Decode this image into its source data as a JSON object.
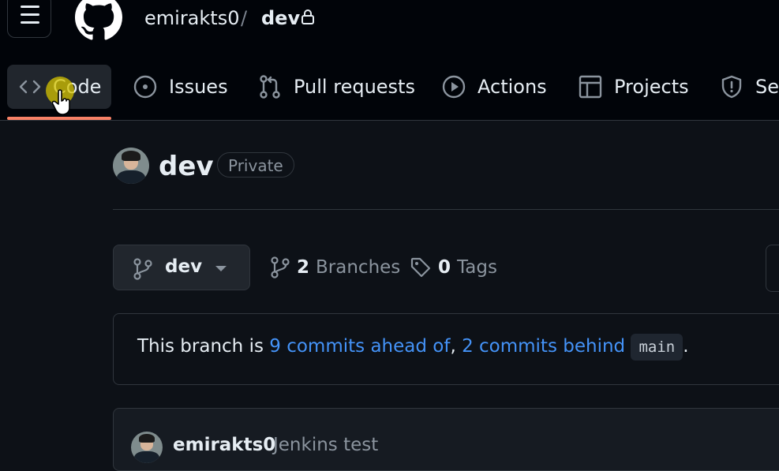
{
  "header": {
    "owner": "emirakts0",
    "separator": "/",
    "repo": "dev"
  },
  "nav": {
    "tabs": [
      {
        "label": "Code",
        "icon": "code-icon",
        "active": true
      },
      {
        "label": "Issues",
        "icon": "issue-opened-icon"
      },
      {
        "label": "Pull requests",
        "icon": "git-pull-request-icon"
      },
      {
        "label": "Actions",
        "icon": "play-icon"
      },
      {
        "label": "Projects",
        "icon": "table-icon"
      },
      {
        "label": "Se",
        "icon": "shield-icon"
      }
    ]
  },
  "repo": {
    "name": "dev",
    "visibility": "Private"
  },
  "branch": {
    "current": "dev",
    "branches_count": "2",
    "branches_label": "Branches",
    "tags_count": "0",
    "tags_label": "Tags"
  },
  "compare": {
    "prefix": "This branch is",
    "ahead": "9 commits ahead of",
    "comma": ",",
    "behind": "2 commits behind",
    "base": "main",
    "suffix": "."
  },
  "commit": {
    "author": "emirakts0",
    "message": "Jenkins test"
  },
  "colors": {
    "background": "#0d1117",
    "header": "#010409",
    "accent_underline": "#f78166",
    "link": "#4493f8"
  }
}
